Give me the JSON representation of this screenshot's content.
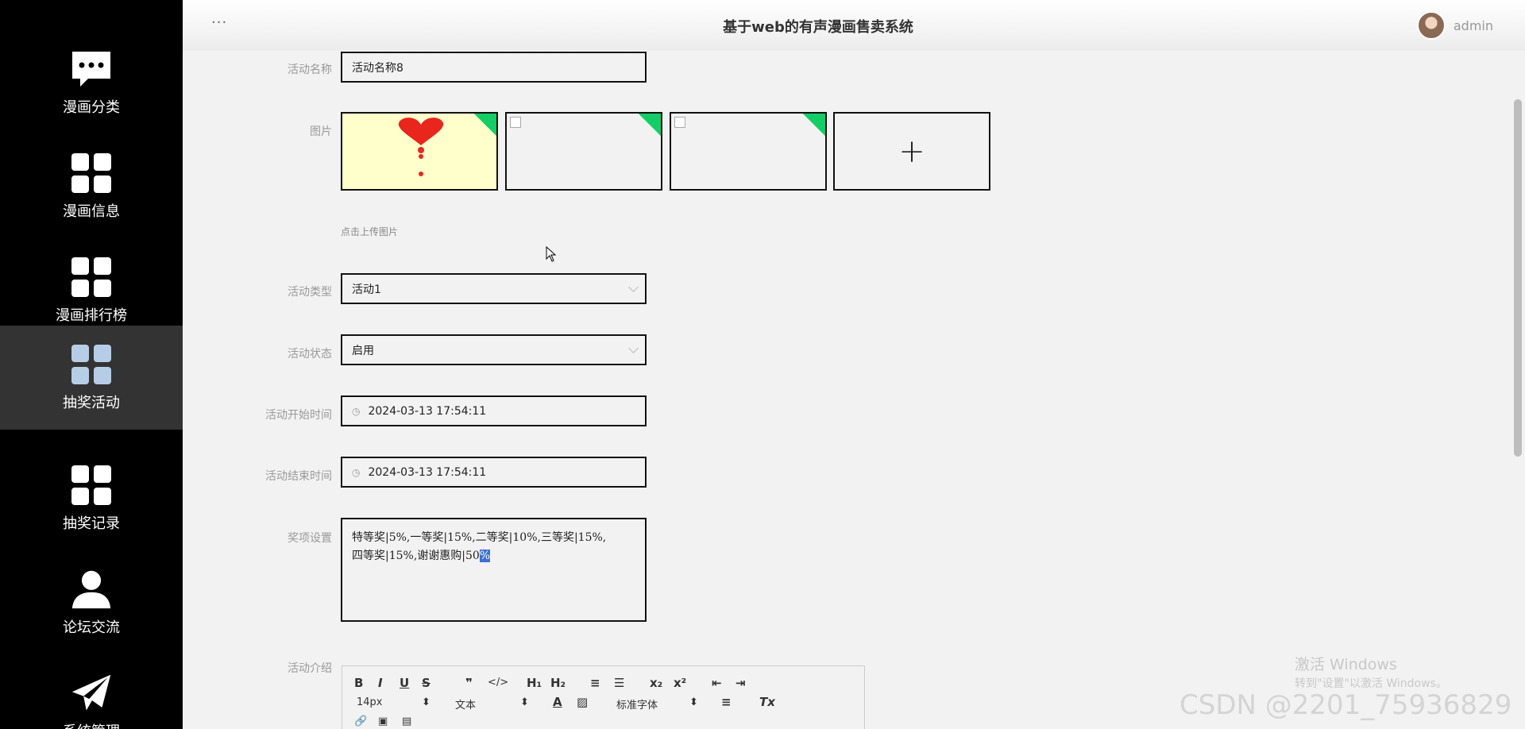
{
  "sidebar": {
    "items": [
      {
        "label": "漫画分类",
        "icon": "chat-bubble-icon"
      },
      {
        "label": "漫画信息",
        "icon": "grid-icon"
      },
      {
        "label": "漫画排行榜",
        "icon": "grid-icon"
      },
      {
        "label": "抽奖活动",
        "icon": "grid-icon",
        "active": true
      },
      {
        "label": "抽奖记录",
        "icon": "grid-icon"
      },
      {
        "label": "论坛交流",
        "icon": "user-icon"
      },
      {
        "label": "系统管理",
        "icon": "paper-plane-icon"
      }
    ]
  },
  "header": {
    "menu_dots": "···",
    "title": "基于web的有声漫画售卖系统",
    "username": "admin"
  },
  "form": {
    "name_label": "活动名称",
    "name_value": "活动名称8",
    "image_label": "图片",
    "upload_hint": "点击上传图片",
    "upload_plus": "+",
    "type_label": "活动类型",
    "type_value": "活动1",
    "status_label": "活动状态",
    "status_value": "启用",
    "start_label": "活动开始时间",
    "start_value": "2024-03-13 17:54:11",
    "end_label": "活动结束时间",
    "end_value": "2024-03-13 17:54:11",
    "prize_label": "奖项设置",
    "prize_line1": "特等奖|5%,一等奖|15%,二等奖|10%,三等奖|15%,",
    "prize_line2_pre": "四等奖|15%,谢谢惠购|50",
    "prize_line2_sel": "%",
    "intro_label": "活动介绍"
  },
  "editor": {
    "bold": "B",
    "italic": "I",
    "underline": "U",
    "strike": "S",
    "quote": "❞",
    "code": "</>",
    "h1": "H₁",
    "h2": "H₂",
    "ol": "≡",
    "ul": "☰",
    "sub": "x₂",
    "sup": "x²",
    "outdent": "⇤",
    "indent": "⇥",
    "size": "14px",
    "para": "文本",
    "font": "标准字体",
    "color": "A",
    "bg": "▨",
    "align": "≡",
    "clear": "Tx",
    "link": "🔗",
    "image": "▣",
    "video": "▤"
  },
  "watermarks": {
    "win1": "激活 Windows",
    "win2": "转到\"设置\"以激活 Windows。",
    "csdn": "CSDN @2201_75936829"
  }
}
